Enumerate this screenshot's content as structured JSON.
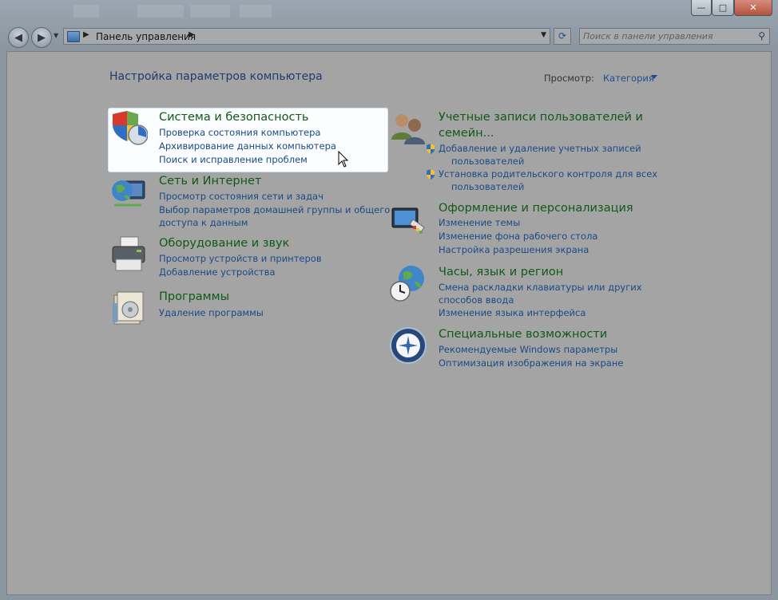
{
  "window": {
    "controls": {
      "minimize": "—",
      "maximize": "□",
      "close": "✕"
    }
  },
  "nav": {
    "back_icon": "◀",
    "forward_icon": "▶",
    "recent_icon": "▼",
    "address": {
      "separator1": "▶",
      "crumb": "Панель управления",
      "separator2": "▶",
      "dropdown": "▼"
    },
    "refresh_icon": "⟳",
    "search": {
      "placeholder": "Поиск в панели управления",
      "icon": "⚲"
    }
  },
  "content": {
    "title": "Настройка параметров компьютера",
    "view_by_label": "Просмотр:",
    "view_by_value": "Категория"
  },
  "categories_left": [
    {
      "title": "Система и безопасность",
      "icon": "shield-chart-icon",
      "links": [
        "Проверка состояния компьютера",
        "Архивирование данных компьютера",
        "Поиск и исправление проблем"
      ]
    },
    {
      "title": "Сеть и Интернет",
      "icon": "network-globe-icon",
      "links": [
        "Просмотр состояния сети и задач",
        "Выбор параметров домашней группы и общего",
        "доступа к данным"
      ]
    },
    {
      "title": "Оборудование и звук",
      "icon": "printer-icon",
      "links": [
        "Просмотр устройств и принтеров",
        "Добавление устройства"
      ]
    },
    {
      "title": "Программы",
      "icon": "programs-icon",
      "links": [
        "Удаление программы"
      ]
    }
  ],
  "categories_right": [
    {
      "title_line1": "Учетные записи пользователей и",
      "title_line2": "семейн...",
      "icon": "users-icon",
      "links": [
        "Добавление и удаление учетных записей",
        "пользователей",
        "Установка родительского контроля для всех",
        "пользователей"
      ]
    },
    {
      "title": "Оформление и персонализация",
      "icon": "monitor-paint-icon",
      "links": [
        "Изменение темы",
        "Изменение фона рабочего стола",
        "Настройка разрешения экрана"
      ]
    },
    {
      "title": "Часы, язык и регион",
      "icon": "clock-globe-icon",
      "links": [
        "Смена раскладки клавиатуры или других",
        "способов ввода",
        "Изменение языка интерфейса"
      ]
    },
    {
      "title": "Специальные возможности",
      "icon": "accessibility-icon",
      "links": [
        "Рекомендуемые Windows параметры",
        "Оптимизация изображения на экране"
      ]
    }
  ],
  "colors": {
    "category_title": "#0f5a17",
    "link": "#1a4a86",
    "page_title": "#1e3c6e"
  }
}
